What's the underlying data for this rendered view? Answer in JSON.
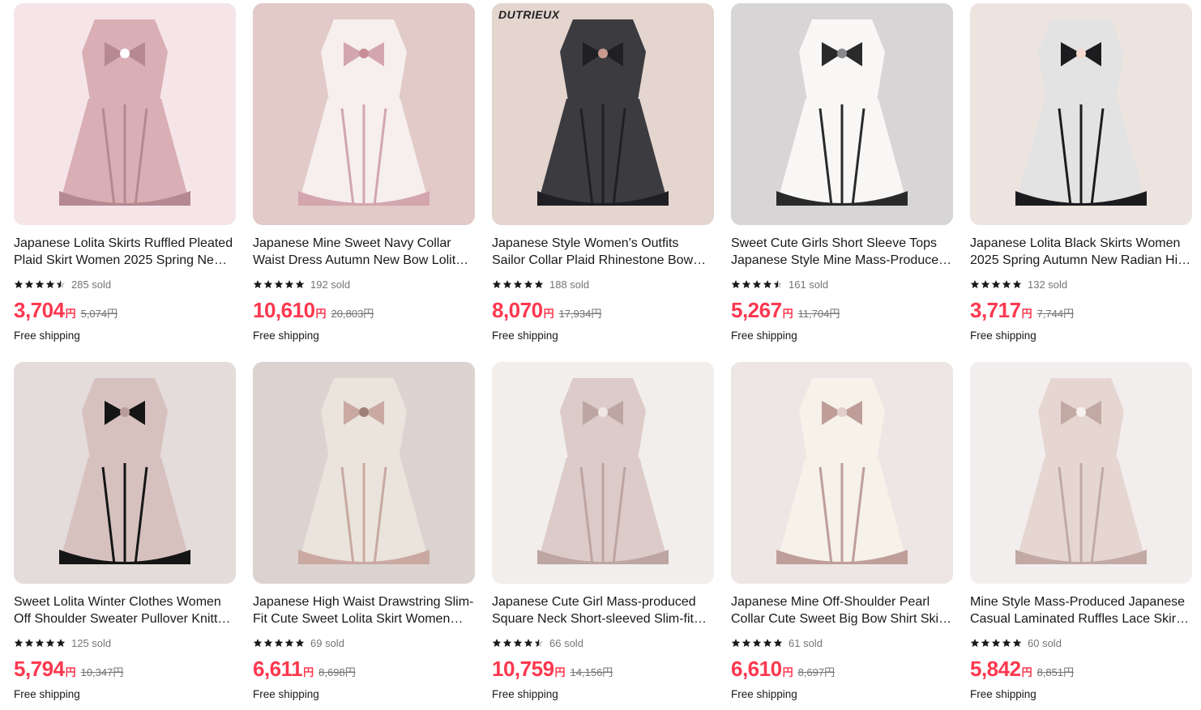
{
  "currency": "円",
  "products": [
    {
      "title": "Japanese Lolita Skirts Ruffled Pleated Plaid Skirt Women 2025 Spring New Sweet Cute",
      "rating": 4.5,
      "sold": "285 sold",
      "price": "3,704",
      "orig": "5,074円",
      "shipping": "Free shipping",
      "brand": "",
      "palette": {
        "bg": "#f2dde1",
        "main": "#d9aeb5",
        "dark": "#b68891",
        "accent": "#ffffff"
      },
      "icon": "pleated-skirt-image"
    },
    {
      "title": "Japanese Mine Sweet Navy Collar Waist Dress Autumn New Bow Lolita Dress",
      "rating": 5,
      "sold": "192 sold",
      "price": "10,610",
      "orig": "20,803円",
      "shipping": "Free shipping",
      "brand": "",
      "palette": {
        "bg": "#eadfd8",
        "main": "#f6efee",
        "dark": "#d3a6ad",
        "accent": "#c78d97"
      },
      "icon": "dress-model-image"
    },
    {
      "title": "Japanese Style Women's Outfits Sailor Collar Plaid Rhinestone Bow Suspender Dress",
      "rating": 5,
      "sold": "188 sold",
      "price": "8,070",
      "orig": "17,934円",
      "shipping": "Free shipping",
      "brand": "DUTRIEUX",
      "palette": {
        "bg": "#eee8e4",
        "main": "#3b3b40",
        "dark": "#1f1f24",
        "accent": "#c99a8e"
      },
      "icon": "sailor-outfit-image"
    },
    {
      "title": "Sweet Cute Girls Short Sleeve Tops Japanese Style Mine Mass-Produced Shirt Lace Bow",
      "rating": 4.5,
      "sold": "161 sold",
      "price": "5,267",
      "orig": "11,704円",
      "shipping": "Free shipping",
      "brand": "",
      "palette": {
        "bg": "#f0eeec",
        "main": "#f8f7f5",
        "dark": "#2a2a2a",
        "accent": "#8a8a8e"
      },
      "icon": "blouse-bow-image"
    },
    {
      "title": "Japanese Lolita Black Skirts Women 2025 Spring Autumn New Radian High Waist Skirt",
      "rating": 5,
      "sold": "132 sold",
      "price": "3,717",
      "orig": "7,744円",
      "shipping": "Free shipping",
      "brand": "",
      "palette": {
        "bg": "#ece8e5",
        "main": "#e3e3e3",
        "dark": "#1c1c1e",
        "accent": "#f4d9cf"
      },
      "icon": "two-models-image"
    },
    {
      "title": "Sweet Lolita Winter Clothes Women Off Shoulder Sweater Pullover Knitted Cardigan",
      "rating": 5,
      "sold": "125 sold",
      "price": "5,794",
      "orig": "10,347円",
      "shipping": "Free shipping",
      "brand": "",
      "palette": {
        "bg": "#f3f1f0",
        "main": "#d7c1bf",
        "dark": "#151515",
        "accent": "#b99c9a"
      },
      "icon": "sweater-image"
    },
    {
      "title": "Japanese High Waist Drawstring Slim-Fit Cute Sweet Lolita Skirt Women Tiered",
      "rating": 5,
      "sold": "69 sold",
      "price": "6,611",
      "orig": "8,698円",
      "shipping": "Free shipping",
      "brand": "",
      "palette": {
        "bg": "#f1efed",
        "main": "#eae4dc",
        "dark": "#c9a9a2",
        "accent": "#a07f7a"
      },
      "icon": "tiered-skirt-image"
    },
    {
      "title": "Japanese Cute Girl Mass-produced Square Neck Short-sleeved Slim-fit Bow Dress",
      "rating": 4.5,
      "sold": "66 sold",
      "price": "10,759",
      "orig": "14,156円",
      "shipping": "Free shipping",
      "brand": "",
      "palette": {
        "bg": "#f2f0ef",
        "main": "#dccbc8",
        "dark": "#bda5a2",
        "accent": "#efe6e3"
      },
      "icon": "bow-dress-image"
    },
    {
      "title": "Japanese Mine Off-Shoulder Pearl Collar Cute Sweet Big Bow Shirt Skirt Set",
      "rating": 5,
      "sold": "61 sold",
      "price": "6,610",
      "orig": "8,697円",
      "shipping": "Free shipping",
      "brand": "",
      "palette": {
        "bg": "#f0eeec",
        "main": "#f6f1e9",
        "dark": "#bf9e9a",
        "accent": "#e2cfcc"
      },
      "icon": "shirt-skirt-set-image"
    },
    {
      "title": "Mine Style Mass-Produced Japanese Casual Laminated Ruffles Lace Skirt Culottes",
      "rating": 5,
      "sold": "60 sold",
      "price": "5,842",
      "orig": "8,851円",
      "shipping": "Free shipping",
      "brand": "",
      "palette": {
        "bg": "#f1eeec",
        "main": "#e6d6d1",
        "dark": "#c2a9a4",
        "accent": "#f7f1ee"
      },
      "icon": "laminated-skirt-image"
    }
  ]
}
